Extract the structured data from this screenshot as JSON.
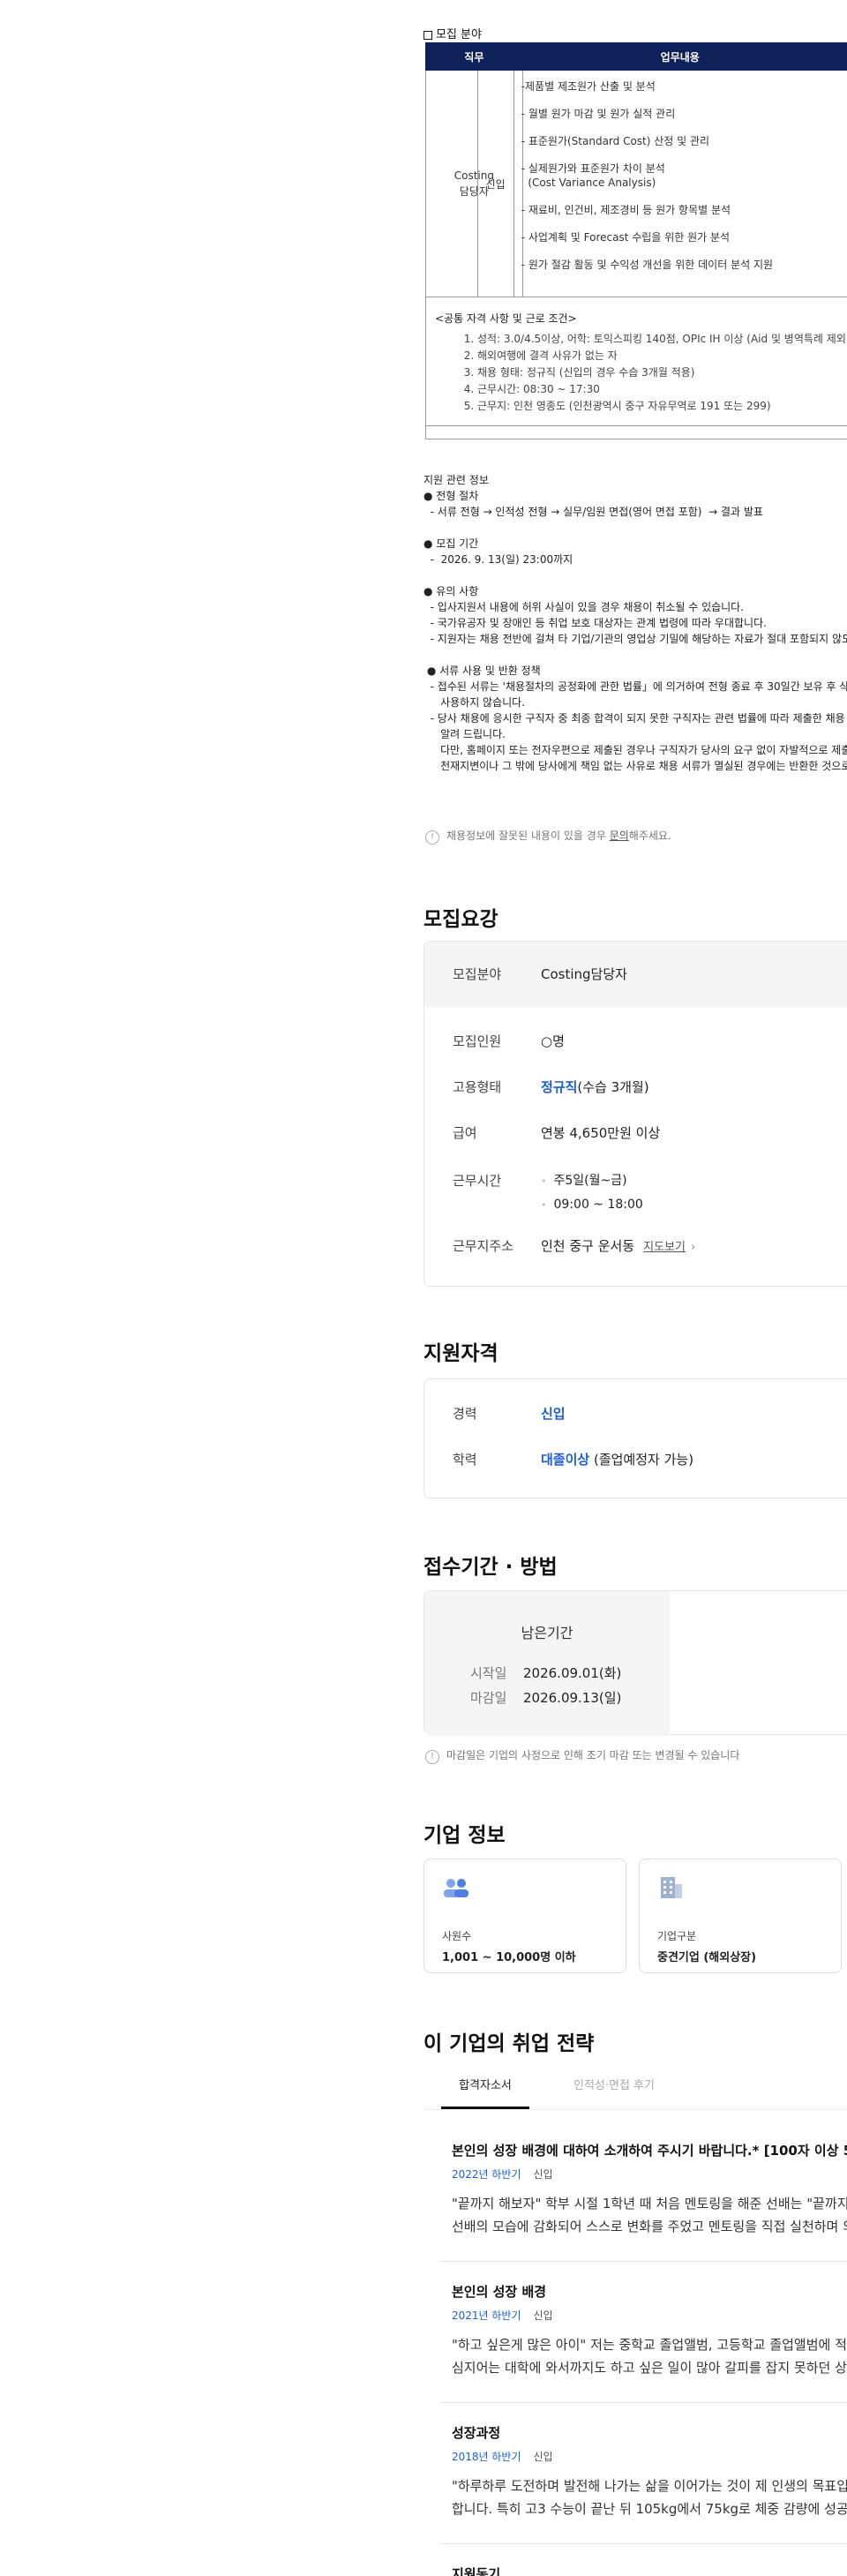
{
  "recruit_field_label": "모집 분야",
  "table": {
    "headers": [
      "직무",
      "업무내용"
    ],
    "role": "Costing\n담당자",
    "level": "신입",
    "duties": [
      "-제품별 제조원가 산출 및 분석",
      "- 월별 원가 마감 및 원가 실적 관리",
      "- 표준원가(Standard Cost) 산정 및 관리",
      "- 실제원가와 표준원가 차이 분석\n  (Cost Variance Analysis)",
      "- 재료비, 인건비, 제조경비 등 원가 항목별 분석",
      "- 사업계획 및 Forecast 수립을 위한 원가 분석",
      "- 원가 절감 활동 및 수익성 개선을 위한 데이터 분석 지원"
    ]
  },
  "common": {
    "title": "<공통 자격 사항 및 근로 조건>",
    "items": [
      "성적: 3.0/4.5이상, 어학: 토익스피킹 140점, OPIc IH 이상 (Aid 및 병역특례 제외)",
      "해외여행에 결격 사유가 없는 자",
      "채용 형태: 정규직 (신입의 경우 수습 3개월 적용)",
      "근무시간: 08:30 ~ 17:30",
      "근무지: 인천 영종도 (인천광역시 중구 자유무역로 191 또는 299)"
    ]
  },
  "notes": [
    {
      "h": "지원 관련 정보",
      "lines": [
        "● 전형 절차",
        "  - 서류 전형 → 인적성 전형 → 실무/임원 면접(영어 면접 포함)  → 결과 발표"
      ]
    },
    {
      "h": "● 모집 기간",
      "lines": [
        "  -  2026. 9. 13(일) 23:00까지"
      ]
    },
    {
      "h": "● 유의 사항",
      "lines": [
        "  - 입사지원서 내용에 허위 사실이 있을 경우 채용이 취소될 수 있습니다.",
        "  - 국가유공자 및 장애인 등 취업 보호 대상자는 관계 법령에 따라 우대합니다.",
        "  - 지원자는 채용 전반에 걸쳐 타 기업/기관의 영업상 기밀에 해당하는 자료가 절대 포함되지 않도"
      ]
    },
    {
      "h": " ● 서류 사용 및 반환 정책",
      "lines": [
        "  - 접수된 서류는 '채용절차의 공정화에 관한 법률」에 의거하여 전형 종료 후 30일간 보유 후 삭제",
        "     사용하지 않습니다.",
        "  - 당사 채용에 응시한 구직자 중 최종 합격이 되지 못한 구직자는 관련 법률에 따라 제출한 채용 서",
        "     알려 드립니다.",
        "     다만, 홈페이지 또는 전자우편으로 제출된 경우나 구직자가 당사의 요구 없이 자발적으로 제출",
        "     천재지변이나 그 밖에 당사에게 책임 없는 사유로 채용 서류가 멸실된 경우에는 반환한 것으로"
      ]
    }
  ],
  "report": {
    "prefix": "채용정보에 잘못된 내용이 있을 경우 ",
    "link": "문의",
    "suffix": "해주세요."
  },
  "requirements": {
    "title": "모집요강",
    "field_k": "모집분야",
    "field_v": "Costing담당자",
    "count_k": "모집인원",
    "count_v": "○명",
    "type_k": "고용형태",
    "type_v": "정규직",
    "type_extra": "(수습 3개월)",
    "pay_k": "급여",
    "pay_v": "연봉 4,650만원 이상",
    "hours_k": "근무시간",
    "hours_1": "주5일(월~금)",
    "hours_2": "09:00 ~ 18:00",
    "addr_k": "근무지주소",
    "addr_v": "인천 중구 운서동",
    "map": "지도보기"
  },
  "qualification": {
    "title": "지원자격",
    "career_k": "경력",
    "career_v": "신입",
    "edu_k": "학력",
    "edu_v": "대졸이상",
    "edu_extra": "(졸업예정자 가능)"
  },
  "apply": {
    "title": "접수기간 · 방법",
    "remaining": "남은기간",
    "start_k": "시작일",
    "start_v": "2026.09.01(화)",
    "end_k": "마감일",
    "end_v": "2026.09.13(일)",
    "notice": "마감일은 기업의 사정으로 인해 조기 마감 또는 변경될 수 있습니다"
  },
  "company": {
    "title": "기업 정보",
    "emp_k": "사원수",
    "emp_v": "1,001 ~ 10,000명 이하",
    "kind_k": "기업구분",
    "kind_v": "중견기업 (해외상장)"
  },
  "strategy": {
    "title": "이 기업의 취업 전략",
    "tab1": "합격자소서",
    "tab2": "인적성·면접 후기",
    "essays": [
      {
        "q": "본인의 성장 배경에 대하여 소개하여 주시기 바랍니다.* [100자 이상 50",
        "sem": "2022년 하반기",
        "lv": "신입",
        "b1": "\"끝까지 해보자\" 학부 시절 1학년 때 처음 멘토링을 해준 선배는 \"끝까지",
        "b2": "선배의 모습에 감화되어 스스로 변화를 주었고 멘토링을 직접 실천하며 의"
      },
      {
        "q": "본인의 성장 배경",
        "sem": "2021년 하반기",
        "lv": "신입",
        "b1": "\"하고 싶은게 많은 아이\" 저는 중학교 졸업앨범, 고등학교 졸업앨범에 적힌",
        "b2": "심지어는 대학에 와서까지도 하고 싶은 일이 많아 갈피를 잡지 못하던 상"
      },
      {
        "q": "성장과정",
        "sem": "2018년 하반기",
        "lv": "신입",
        "b1": "\"하루하루 도전하며 발전해 나가는 삶을 이어가는 것이 제 인생의 목표입",
        "b2": "합니다. 특히 고3 수능이 끝난 뒤 105kg에서 75kg로 체중 감량에 성공했"
      },
      {
        "q": "지원동기",
        "sem": "",
        "lv": "",
        "b1": "",
        "b2": ""
      }
    ]
  }
}
